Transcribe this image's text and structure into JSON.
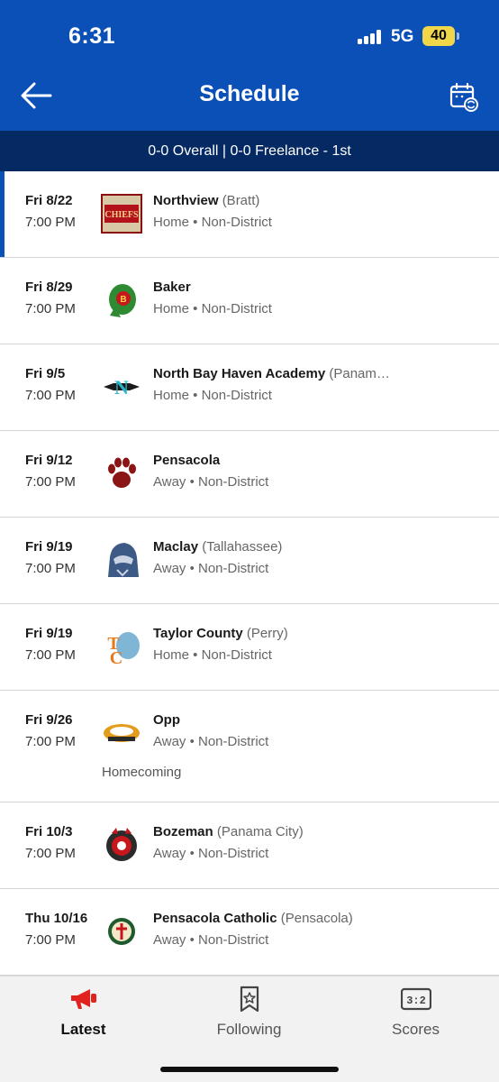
{
  "status": {
    "time": "6:31",
    "network": "5G",
    "battery": "40"
  },
  "header": {
    "title": "Schedule",
    "back_icon": "arrow-left-icon",
    "calendar_icon": "calendar-sync-icon"
  },
  "record": "0-0 Overall | 0-0 Freelance - 1st",
  "games": [
    {
      "date": "Fri 8/22",
      "time": "7:00 PM",
      "opponent": "Northview",
      "location": "(Bratt)",
      "meta": "Home • Non-District",
      "note": ""
    },
    {
      "date": "Fri 8/29",
      "time": "7:00 PM",
      "opponent": "Baker",
      "location": "",
      "meta": "Home • Non-District",
      "note": ""
    },
    {
      "date": "Fri 9/5",
      "time": "7:00 PM",
      "opponent": "North Bay Haven Academy",
      "location": "(Panam…",
      "meta": "Home • Non-District",
      "note": ""
    },
    {
      "date": "Fri 9/12",
      "time": "7:00 PM",
      "opponent": "Pensacola",
      "location": "",
      "meta": "Away • Non-District",
      "note": ""
    },
    {
      "date": "Fri 9/19",
      "time": "7:00 PM",
      "opponent": "Maclay",
      "location": "(Tallahassee)",
      "meta": "Away • Non-District",
      "note": ""
    },
    {
      "date": "Fri 9/19",
      "time": "7:00 PM",
      "opponent": "Taylor County",
      "location": "(Perry)",
      "meta": "Home • Non-District",
      "note": ""
    },
    {
      "date": "Fri 9/26",
      "time": "7:00 PM",
      "opponent": "Opp",
      "location": "",
      "meta": "Away • Non-District",
      "note": "Homecoming"
    },
    {
      "date": "Fri 10/3",
      "time": "7:00 PM",
      "opponent": "Bozeman",
      "location": "(Panama City)",
      "meta": "Away • Non-District",
      "note": ""
    },
    {
      "date": "Thu 10/16",
      "time": "7:00 PM",
      "opponent": "Pensacola Catholic",
      "location": "(Pensacola)",
      "meta": "Away • Non-District",
      "note": ""
    }
  ],
  "tabs": [
    {
      "label": "Latest",
      "icon": "megaphone-icon",
      "active": true
    },
    {
      "label": "Following",
      "icon": "bookmark-star-icon",
      "active": false
    },
    {
      "label": "Scores",
      "icon": "scoreboard-icon",
      "active": false
    }
  ],
  "colors": {
    "header": "#0a50b7",
    "record_bar": "#052a63",
    "active_tab": "#e0231f",
    "logo_text": "CHIEFS"
  }
}
